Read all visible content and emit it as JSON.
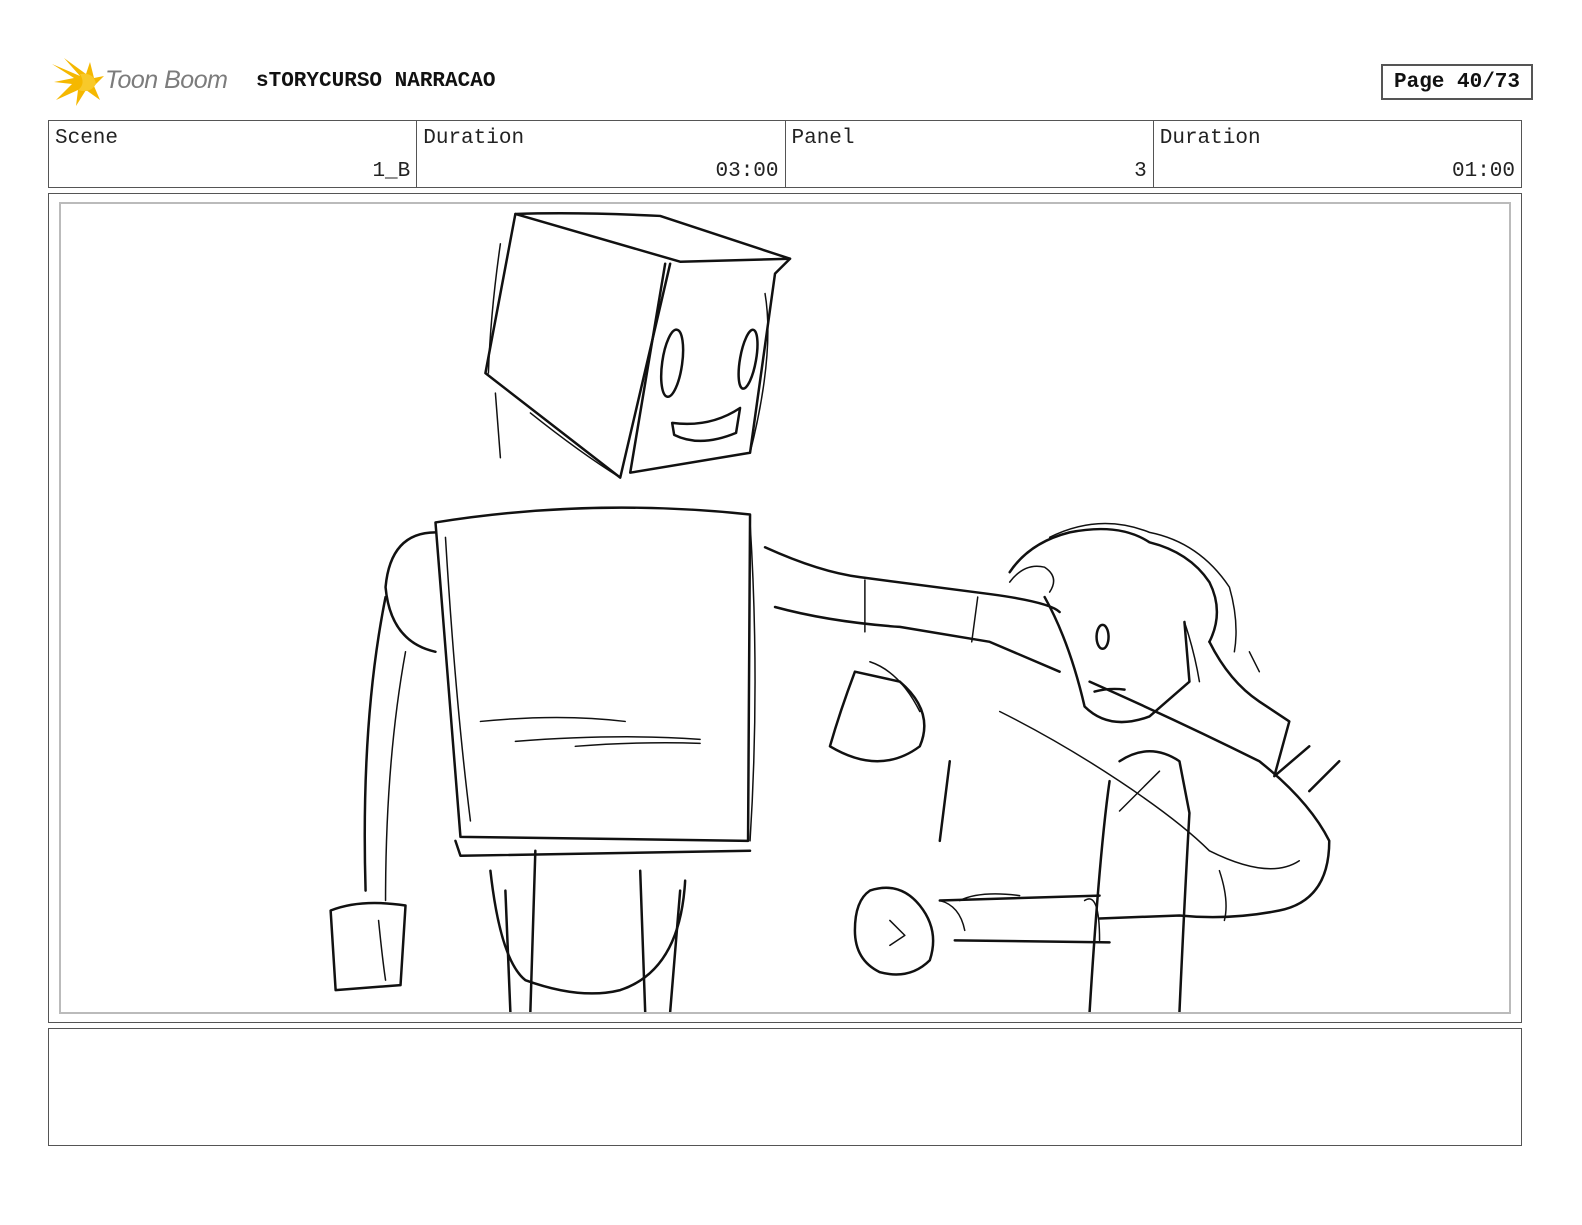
{
  "header": {
    "logo_text": "Toon Boom",
    "project_title": "sTORYCURSO NARRACAO",
    "page_label": "Page 40/73"
  },
  "info": {
    "scene_label": "Scene",
    "scene_value": "1_B",
    "scene_duration_label": "Duration",
    "scene_duration_value": "03:00",
    "panel_label": "Panel",
    "panel_value": "3",
    "panel_duration_label": "Duration",
    "panel_duration_value": "01:00"
  },
  "notes": {
    "text": ""
  },
  "colors": {
    "logo_yellow": "#f5b800",
    "border": "#555555",
    "sketch_line": "#111111"
  }
}
